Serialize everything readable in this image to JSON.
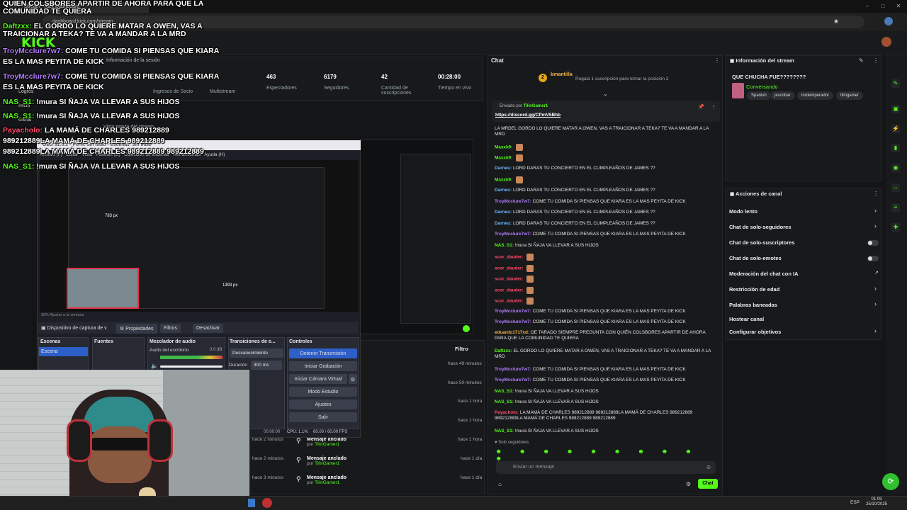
{
  "browser": {
    "tab_title": "Stream - Kick Dashboard",
    "address": "dashboard.kick.com/stream"
  },
  "session": {
    "header": "Información de la sesión",
    "stats": [
      {
        "value": "463",
        "label": "Espectadores"
      },
      {
        "value": "6179",
        "label": "Seguidores"
      },
      {
        "value": "42",
        "label": "Cantidad de suscripciones"
      },
      {
        "value": "00:28:00",
        "label": "Tiempo en vivo"
      }
    ],
    "left_labels": [
      "Ingresos de Socio",
      "Multistream"
    ],
    "left_nav": [
      "Logros",
      "Inicio",
      "Canal"
    ],
    "preview_header": "Vista previa del stream"
  },
  "overlay_chat": [
    {
      "user": "",
      "text": "QUIEN COLSBORES APARTIR DE AHORA PARA QUE LA",
      "ucolor": "#ffffff"
    },
    {
      "user": "",
      "text": "COMUNIDAD TE QUIERA",
      "ucolor": "#ffffff"
    },
    {
      "user": "Daftzxx:",
      "text": "EL GORDO LO QUIERE MATAR A OWEN, VAS A",
      "ucolor": "#53fc18"
    },
    {
      "user": "",
      "text": "TRAICIONAR A TEKA? TE VA A MANDAR A LA MRD",
      "ucolor": "#ffffff"
    },
    {
      "user": "TroyMcclure7w7:",
      "text": "COME TU COMIDA SI PIENSAS QUE KIARA",
      "ucolor": "#b57bff"
    },
    {
      "user": "",
      "text": "ES LA MAS PEYITA DE KICK",
      "ucolor": "#ffffff"
    },
    {
      "user": "TroyMcclure7w7:",
      "text": "COME TU COMIDA SI PIENSAS QUE KIARA",
      "ucolor": "#b57bff"
    },
    {
      "user": "",
      "text": "ES LA MAS PEYITA DE KICK",
      "ucolor": "#ffffff"
    },
    {
      "user": "NAS_S1:",
      "text": "!mura SI ÑAJA VA LLEVAR A SUS HIJOS",
      "ucolor": "#53fc18"
    },
    {
      "user": "NAS_S1:",
      "text": "!mura SI ÑAJA VA LLEVAR A SUS HIJOS",
      "ucolor": "#53fc18"
    },
    {
      "user": "Payacholo:",
      "text": "LA MAMÁ DE CHARLES   989212889",
      "ucolor": "#ff4a6b"
    },
    {
      "user": "",
      "text": "989212889LA MAMÁ DE CHARLES   989212889",
      "ucolor": "#ffffff"
    },
    {
      "user": "",
      "text": "989212889LA MAMÁ DE CHARLES   989212889   989212889",
      "ucolor": "#ffffff"
    },
    {
      "user": "NAS_S1:",
      "text": "!mura SI ÑAJA VA LLEVAR A SUS HIJOS",
      "ucolor": "#53fc18"
    }
  ],
  "obs": {
    "title": "OBS 31.0.2 - Perfil: Sin título - Escenas: Sin título",
    "menu": [
      "Archivo (F)",
      "Editar",
      "Vista",
      "Paneles (D)",
      "Colección de escenas",
      "Herramientas",
      "Ayuda (H)"
    ],
    "source_label": "Dispositivo de captura de v",
    "properties": "Propiedades",
    "filters": "Filtros",
    "deactivate": "Desactivar",
    "scenes_header": "Escenas",
    "scene_item": "Escena",
    "sources_header": "Fuentes",
    "mixer_header": "Mezclador de audio",
    "mixer_item": "Audio del escritorio",
    "mixer_db": "0.0 dB",
    "transitions_header": "Transiciones de e...",
    "transition_value": "Desvanecimiento",
    "duration_label": "Duración",
    "duration_value": "300 ms",
    "controls_header": "Controles",
    "controls": [
      "Detener Transmisión",
      "Iniciar Grabación",
      "Iniciar Cámara Virtual",
      "Modo Estudio",
      "Ajustes",
      "Salir"
    ],
    "status_time": "00:00:00",
    "status_cpu": "CPU: 1.1%",
    "status_fps": "60.00 / 60.00 FPS",
    "zoom_hint": "38%  Ajustar a la ventana",
    "size_label": "783 px",
    "size_label2": "1393 px"
  },
  "activity": {
    "filter_label": "Filtro",
    "times": [
      "hace 49 minutos",
      "hace 50 minutos",
      "hace 1 hora",
      "hace 1 hora",
      "hace 1 hora",
      "hace 1 día",
      "hace 1 día"
    ],
    "left_times": [
      "hace 2 minutos",
      "hace 2 minutos",
      "hace 3 minutos"
    ],
    "pinned": [
      {
        "title": "Mensaje anclado",
        "by": "por",
        "user": "TilinGamer1"
      },
      {
        "title": "Mensaje anclado",
        "by": "por",
        "user": "TilinGamer1"
      },
      {
        "title": "Mensaje anclado",
        "by": "por",
        "user": "TilinGamer1"
      }
    ]
  },
  "chat": {
    "header": "Chat",
    "gift_user": "bmantilla",
    "gift_count": "2",
    "gift_text": "Regala 1 suscripción para tomar la posición 2",
    "pinned_by": "Enviado por",
    "pinned_user": "TilinGamer1",
    "pinned_link": "https://discord.gg/CPmV5Bhb",
    "messages": [
      {
        "user": "",
        "text": "LA MRDEL GORDO LO QUIERE MATAR A OWEN, VAS A TRAICIONAR A TEKA? TE VA A MANDAR A LA MRD",
        "c": "#ffffff"
      },
      {
        "user": "Maxxk9:",
        "text": "",
        "c": "#53fc18"
      },
      {
        "user": "Maxxk9:",
        "text": "",
        "c": "#53fc18"
      },
      {
        "user": "Darneu:",
        "text": "LORD DARAS TU CONCIERTO EN EL CUMPLEAÑOS DE JAMES ??",
        "c": "#6cb5ff"
      },
      {
        "user": "Maxxk9:",
        "text": "",
        "c": "#53fc18"
      },
      {
        "user": "Darneu:",
        "text": "LORD DARAS TU CONCIERTO EN EL CUMPLEAÑOS DE JAMES ??",
        "c": "#6cb5ff"
      },
      {
        "user": "TroyMcclure7w7:",
        "text": "COME TU COMIDA SI PIENSAS QUE KIARA ES LA MAS PEYITA DE KICK",
        "c": "#b57bff"
      },
      {
        "user": "Darneu:",
        "text": "LORD DARAS TU CONCIERTO EN EL CUMPLEAÑOS DE JAMES ??",
        "c": "#6cb5ff"
      },
      {
        "user": "Darneu:",
        "text": "LORD DARAS TU CONCIERTO EN EL CUMPLEAÑOS DE JAMES ??",
        "c": "#6cb5ff"
      },
      {
        "user": "TroyMcclure7w7:",
        "text": "COME TU COMIDA SI PIENSAS QUE KIARA ES LA MAS PEYITA DE KICK",
        "c": "#b57bff"
      },
      {
        "user": "NAS_S1:",
        "text": "!mura SI ÑAJA VA LLEVAR A SUS HIJOS",
        "c": "#53fc18"
      },
      {
        "user": "scor_dauder:",
        "text": "",
        "c": "#ff4a6b"
      },
      {
        "user": "scor_dauder:",
        "text": "",
        "c": "#ff4a6b"
      },
      {
        "user": "scor_dauder:",
        "text": "",
        "c": "#ff4a6b"
      },
      {
        "user": "scor_dauder:",
        "text": "",
        "c": "#ff4a6b"
      },
      {
        "user": "scor_dauder:",
        "text": "",
        "c": "#ff4a6b"
      },
      {
        "user": "TroyMcclure7w7:",
        "text": "COME TU COMIDA SI PIENSAS QUE KIARA ES LA MAS PEYITA DE KICK",
        "c": "#b57bff"
      },
      {
        "user": "TroyMcclure7w7:",
        "text": "COME TU COMIDA SI PIENSAS QUE KIARA ES LA MAS PEYITA DE KICK",
        "c": "#b57bff"
      },
      {
        "user": "eduardo1717xd:",
        "text": "OE TARADO SIEMPRE PREGUNTA CON QUIÉN COLSBORES APARTIR DE AHORA PARA QUE LA COMUNIDAD TE QUIERA",
        "c": "#f5b642"
      },
      {
        "user": "Daftzxx:",
        "text": "EL GORDO LO QUIERE MATAR A OWEN, VAS A TRAICIONAR A TEKA? TE VA A MANDAR A LA MRD",
        "c": "#53fc18"
      },
      {
        "user": "TroyMcclure7w7:",
        "text": "COME TU COMIDA SI PIENSAS QUE KIARA ES LA MAS PEYITA DE KICK",
        "c": "#b57bff"
      },
      {
        "user": "TroyMcclure7w7:",
        "text": "COME TU COMIDA SI PIENSAS QUE KIARA ES LA MAS PEYITA DE KICK",
        "c": "#b57bff"
      },
      {
        "user": "NAS_S1:",
        "text": "!mura SI ÑAJA VA LLEVAR A SUS HIJOS",
        "c": "#53fc18"
      },
      {
        "user": "NAS_S1:",
        "text": "!mura SI ÑAJA VA LLEVAR A SUS HIJOS",
        "c": "#53fc18"
      },
      {
        "user": "Payacholo:",
        "text": "LA MAMÁ DE CHARLES  989212889  989212889LA MAMÁ DE CHARLES  989212889  989212889LA MAMÁ DE CHARLES  989212889  989212889",
        "c": "#ff4a6b"
      },
      {
        "user": "NAS_S1:",
        "text": "!mura SI ÑAJA VA LLEVAR A SUS HIJOS",
        "c": "#53fc18"
      }
    ],
    "followers_only": "Solo seguidores",
    "input_placeholder": "Enviar un mensaje",
    "send_label": "Chat"
  },
  "stream_info": {
    "header": "Información del stream",
    "title": "QUE CHUCHA FUE????????",
    "category": "Conversando",
    "tags": [
      "Spanish",
      "jescobar",
      "lordemperador",
      "tilingamer"
    ]
  },
  "channel_actions": {
    "header": "Acciones de canal",
    "items": [
      {
        "label": "Modo lento",
        "kind": "chevron"
      },
      {
        "label": "Chat de solo-seguidores",
        "kind": "chevron"
      },
      {
        "label": "Chat de solo-suscriptores",
        "kind": "toggle"
      },
      {
        "label": "Chat de solo-emotes",
        "kind": "toggle"
      },
      {
        "label": "Moderación del chat con IA",
        "kind": "link"
      },
      {
        "label": "Restricción de edad",
        "kind": "chevron"
      },
      {
        "label": "Palabras baneadas",
        "kind": "chevron"
      },
      {
        "label": "Hostear canal",
        "kind": "none"
      },
      {
        "label": "Configurar objetivos",
        "kind": "chevron"
      }
    ]
  },
  "taskbar": {
    "lang": "ESP",
    "time": "01:09",
    "date": "25/10/2025"
  },
  "colors": {
    "kick_green": "#53fc18",
    "bg": "#141517"
  }
}
